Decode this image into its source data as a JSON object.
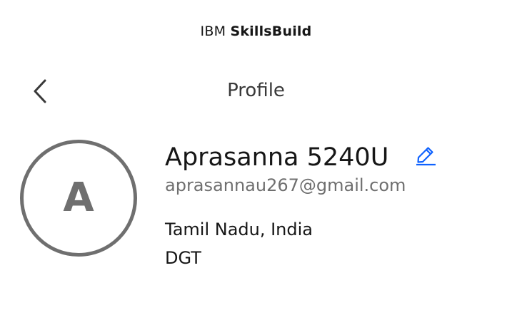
{
  "header": {
    "brand_prefix": "IBM",
    "brand_product": "SkillsBuild",
    "title": "Profile",
    "back_icon": "chevron-left-icon"
  },
  "profile": {
    "avatar_initial": "A",
    "name": "Aprasanna 5240U",
    "edit_icon": "pencil-edit-icon",
    "email": "aprasannau267@gmail.com",
    "location": "Tamil Nadu, India",
    "organization": "DGT"
  },
  "colors": {
    "text_primary": "#161616",
    "text_secondary": "#6f6f6f",
    "accent": "#0f62fe",
    "avatar_border": "#6f6f6f"
  }
}
